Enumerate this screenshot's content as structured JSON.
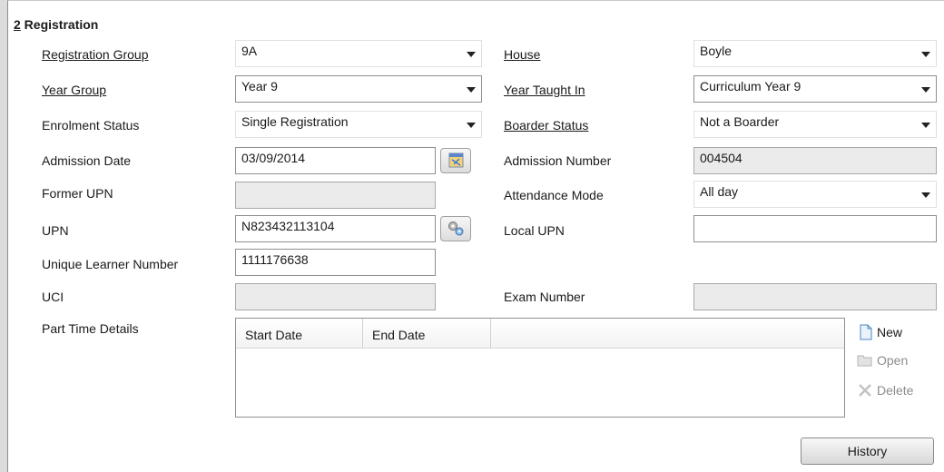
{
  "section": {
    "number": "2",
    "title": " Registration"
  },
  "fields": {
    "registration_group": {
      "label": "Registration Group",
      "value": "9A"
    },
    "house": {
      "label": "House",
      "value": "Boyle"
    },
    "year_group": {
      "label": "Year Group",
      "value": "Year 9"
    },
    "year_taught_in": {
      "label": "Year Taught In",
      "value": "Curriculum Year 9"
    },
    "enrolment_status": {
      "label": "Enrolment Status",
      "value": "Single Registration"
    },
    "boarder_status": {
      "label": "Boarder Status",
      "value": "Not a Boarder"
    },
    "admission_date": {
      "label": "Admission Date",
      "value": "03/09/2014"
    },
    "admission_number": {
      "label": "Admission Number",
      "value": "004504"
    },
    "former_upn": {
      "label": "Former UPN",
      "value": ""
    },
    "attendance_mode": {
      "label": "Attendance Mode",
      "value": "All day"
    },
    "upn": {
      "label": "UPN",
      "value": "N823432113104"
    },
    "local_upn": {
      "label": "Local UPN",
      "value": ""
    },
    "uln": {
      "label": "Unique Learner Number",
      "value": "1111176638"
    },
    "uci": {
      "label": "UCI",
      "value": ""
    },
    "exam_number": {
      "label": "Exam Number",
      "value": ""
    },
    "part_time": {
      "label": "Part Time Details"
    }
  },
  "grid": {
    "columns": [
      "Start Date",
      "End Date",
      ""
    ]
  },
  "actions": {
    "new": "New",
    "open": "Open",
    "delete": "Delete"
  },
  "history_button": "History",
  "icons": {
    "date_picker": "calendar-icon",
    "generate_upn": "gears-icon",
    "new": "document-icon",
    "open": "folder-icon",
    "delete": "x-icon"
  }
}
